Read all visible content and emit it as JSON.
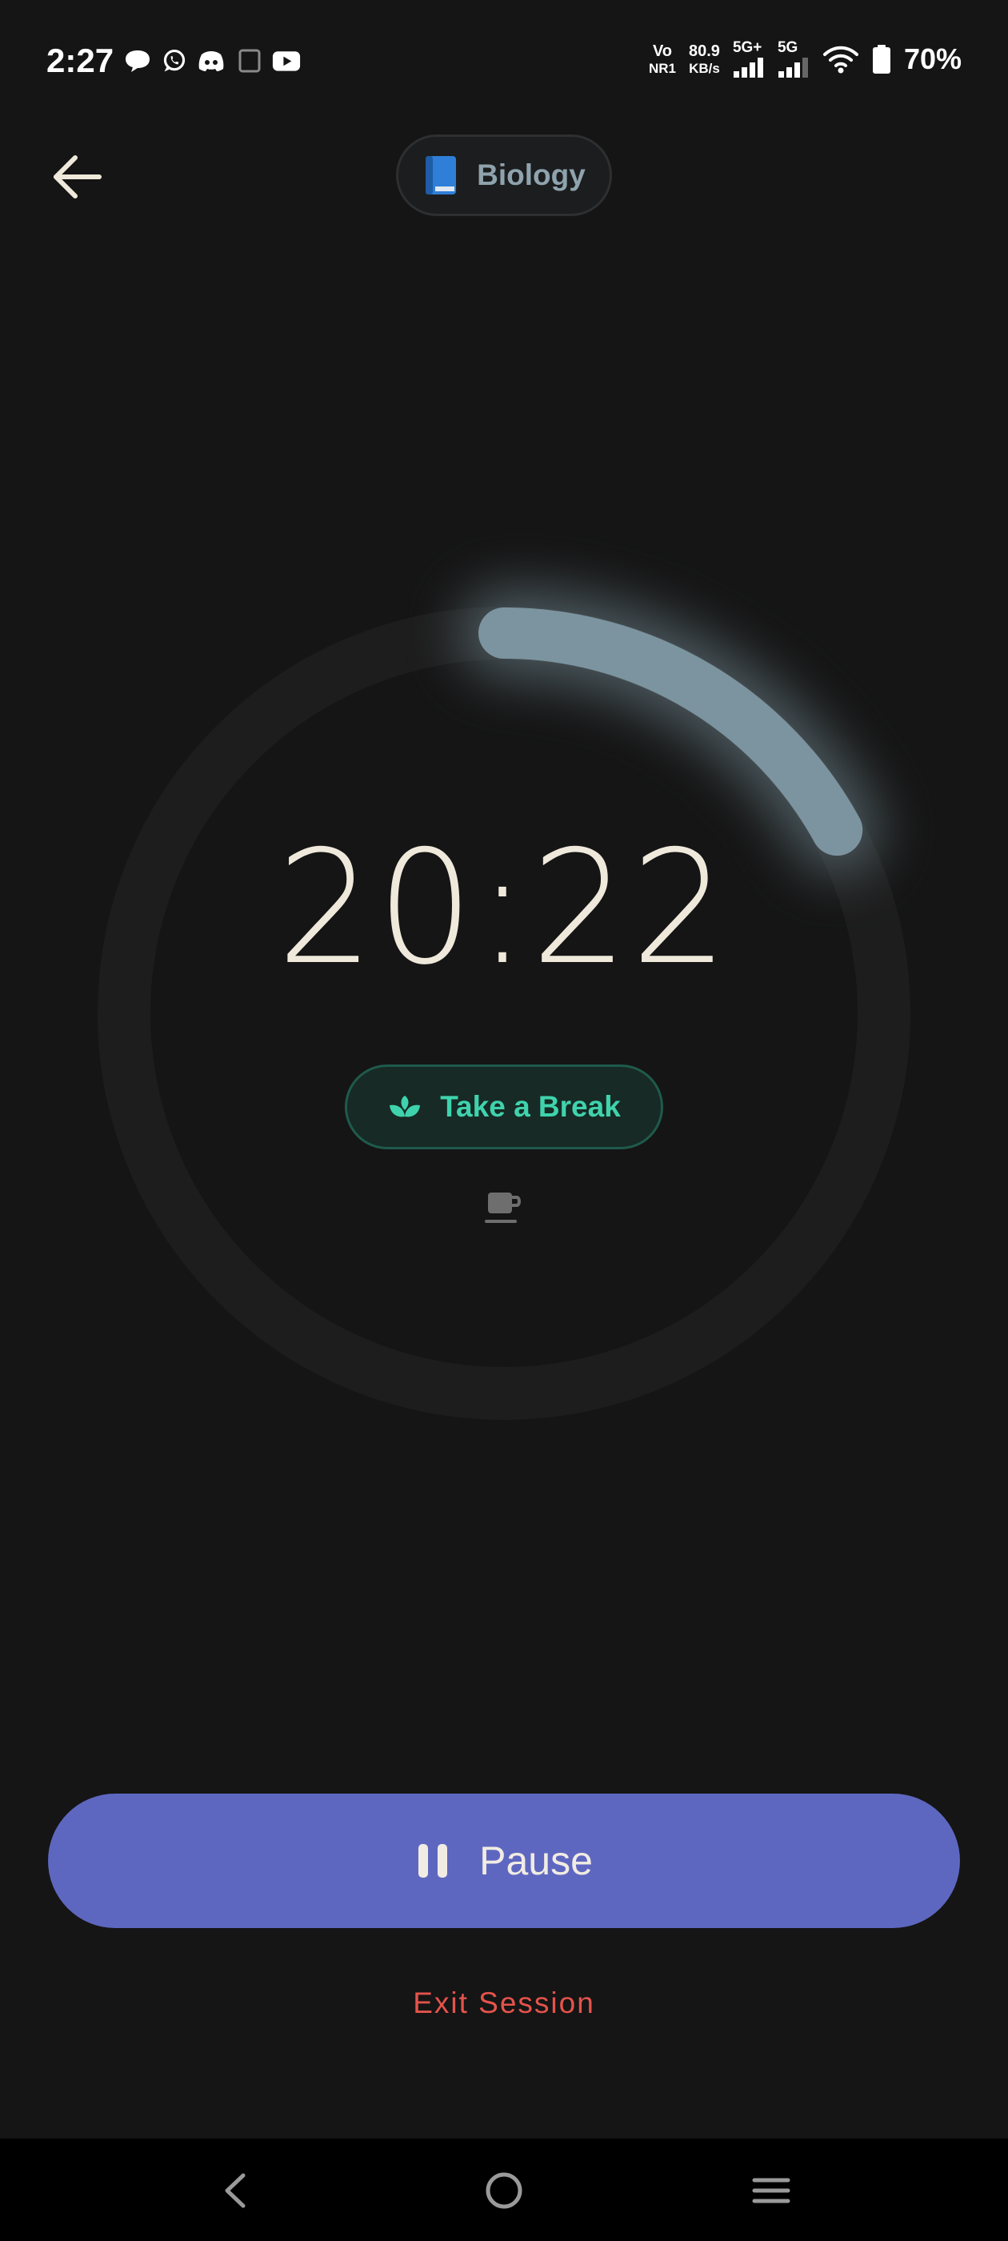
{
  "status_bar": {
    "time": "2:27",
    "network_top": "Vo",
    "network_bottom": "NR1",
    "speed_value": "80.9",
    "speed_unit": "KB/s",
    "sim1_label": "5G+",
    "sim2_label": "5G",
    "battery_percent": "70%",
    "icons": [
      "chat-icon",
      "whatsapp-icon",
      "discord-icon",
      "screen-icon",
      "youtube-icon",
      "wifi-icon",
      "battery-icon"
    ]
  },
  "header": {
    "back_icon": "arrow-left-icon",
    "subject_icon": "book-icon",
    "subject_label": "Biology"
  },
  "timer": {
    "time_display": "20:22",
    "progress_fraction": 0.17,
    "ring_color": "#7c949f",
    "track_color": "#1d1d1d",
    "break_button_label": "Take a Break",
    "break_icon": "sprout-icon",
    "coffee_icon": "coffee-cup-icon"
  },
  "controls": {
    "pause_label": "Pause",
    "pause_icon": "pause-icon",
    "exit_label": "Exit Session"
  },
  "colors": {
    "background": "#151515",
    "accent": "#5e67c0",
    "break_accent": "#3fd3ad",
    "danger": "#e5534b"
  },
  "nav_bar": {
    "icons": [
      "back-chevron-icon",
      "home-circle-icon",
      "menu-lines-icon"
    ]
  }
}
